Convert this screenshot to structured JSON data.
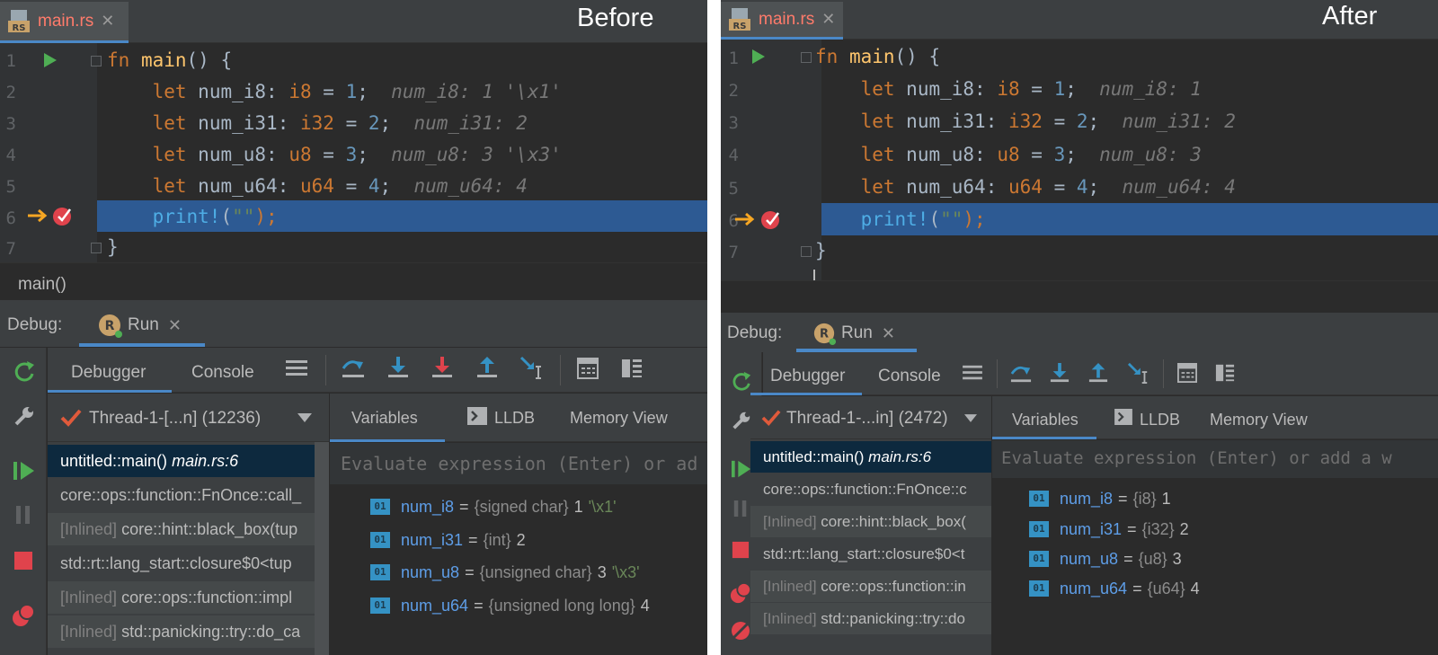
{
  "left": {
    "caption": "Before",
    "file_tab": "main.rs",
    "close_glyph": "✕",
    "lines": [
      "1",
      "2",
      "3",
      "4",
      "5",
      "6",
      "7"
    ],
    "breadcrumb": "main()",
    "debug_label": "Debug:",
    "run_tab": "Run",
    "tabs": {
      "debugger": "Debugger",
      "console": "Console"
    },
    "thread": "Thread-1-[...n] (12236)",
    "frames": [
      {
        "name": "untitled::main()",
        "loc": "main.rs:6"
      },
      {
        "name": "core::ops::function::FnOnce::call_"
      },
      {
        "prefix": "[Inlined]",
        "name": "core::hint::black_box(tup"
      },
      {
        "name": "std::rt::lang_start::closure$0<tup"
      },
      {
        "prefix": "[Inlined]",
        "name": "core::ops::function::impl"
      },
      {
        "prefix": "[Inlined]",
        "name": "std::panicking::try::do_ca"
      }
    ],
    "var_tabs": {
      "variables": "Variables",
      "lldb": "LLDB",
      "memory": "Memory View"
    },
    "eval_placeholder": "Evaluate expression (Enter) or ad",
    "code": {
      "hints": [
        "num_i8: 1 '\\x1'",
        "num_i31: 2",
        "num_u8: 3 '\\x3'",
        "num_u64: 4"
      ]
    },
    "variables": [
      {
        "name": "num_i8",
        "type": "{signed char}",
        "value": "1",
        "extra": "'\\x1'"
      },
      {
        "name": "num_i31",
        "type": "{int}",
        "value": "2",
        "extra": ""
      },
      {
        "name": "num_u8",
        "type": "{unsigned char}",
        "value": "3",
        "extra": "'\\x3'"
      },
      {
        "name": "num_u64",
        "type": "{unsigned long long}",
        "value": "4",
        "extra": ""
      }
    ]
  },
  "right": {
    "caption": "After",
    "file_tab": "main.rs",
    "close_glyph": "✕",
    "lines": [
      "1",
      "2",
      "3",
      "4",
      "5",
      "6",
      "7"
    ],
    "debug_label": "Debug:",
    "run_tab": "Run",
    "tabs": {
      "debugger": "Debugger",
      "console": "Console"
    },
    "thread": "Thread-1-...in] (2472)",
    "frames": [
      {
        "name": "untitled::main()",
        "loc": "main.rs:6"
      },
      {
        "name": "core::ops::function::FnOnce::c"
      },
      {
        "prefix": "[Inlined]",
        "name": "core::hint::black_box("
      },
      {
        "name": "std::rt::lang_start::closure$0<t"
      },
      {
        "prefix": "[Inlined]",
        "name": "core::ops::function::in"
      },
      {
        "prefix": "[Inlined]",
        "name": "std::panicking::try::do"
      }
    ],
    "var_tabs": {
      "variables": "Variables",
      "lldb": "LLDB",
      "memory": "Memory View"
    },
    "eval_placeholder": "Evaluate expression (Enter) or add a w",
    "code": {
      "hints": [
        "num_i8: 1",
        "num_i31: 2",
        "num_u8: 3",
        "num_u64: 4"
      ]
    },
    "variables": [
      {
        "name": "num_i8",
        "type": "{i8}",
        "value": "1",
        "extra": ""
      },
      {
        "name": "num_i31",
        "type": "{i32}",
        "value": "2",
        "extra": ""
      },
      {
        "name": "num_u8",
        "type": "{u8}",
        "value": "3",
        "extra": ""
      },
      {
        "name": "num_u64",
        "type": "{u64}",
        "value": "4",
        "extra": ""
      }
    ]
  },
  "code_tokens": {
    "fn_kw": "fn",
    "main_name": "main",
    "main_sig": "() {",
    "let_kw": "let",
    "vars": [
      "num_i8",
      "num_i31",
      "num_u8",
      "num_u64"
    ],
    "types": [
      "i8",
      "i32",
      "u8",
      "u64"
    ],
    "values": [
      "1",
      "2",
      "3",
      "4"
    ],
    "print_macro": "print!",
    "print_open": "(",
    "print_str": "\"\"",
    "print_close": ");",
    "close_brace": "}"
  },
  "colors": {
    "accent": "#4a88c7",
    "exec_line": "#2d5a93",
    "selected_frame": "#0d293e",
    "file_tab_text": "#ff7b6b"
  },
  "icons": [
    "rust-file-icon",
    "run-line-icon",
    "execution-arrow-icon",
    "breakpoint-icon",
    "rerun-icon",
    "settings-wrench-icon",
    "resume-icon",
    "pause-icon",
    "stop-icon",
    "view-breakpoints-icon",
    "mute-breakpoints-icon",
    "layout-menu-icon",
    "step-over-icon",
    "step-into-icon",
    "force-step-into-icon",
    "step-out-icon",
    "run-to-cursor-icon",
    "evaluate-icon",
    "memory-layout-icon",
    "thread-check-icon",
    "dropdown-arrow-icon",
    "variable-icon",
    "lldb-console-icon"
  ]
}
